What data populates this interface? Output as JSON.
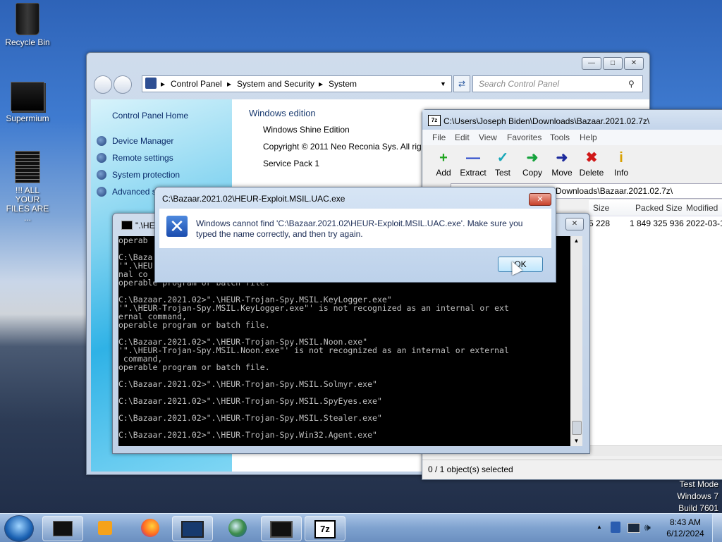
{
  "desktop": {
    "icons": [
      {
        "label": "Recycle Bin"
      },
      {
        "label": "Supermium"
      },
      {
        "label": "!!! ALL YOUR FILES ARE ..."
      }
    ],
    "watermark": [
      "Test Mode",
      "Windows 7",
      "Build 7601"
    ]
  },
  "control_panel": {
    "breadcrumb": [
      "Control Panel",
      "System and Security",
      "System"
    ],
    "search_placeholder": "Search Control Panel",
    "home_link": "Control Panel Home",
    "side_links": [
      "Device Manager",
      "Remote settings",
      "System protection",
      "Advanced s"
    ],
    "section_title": "Windows edition",
    "edition": "Windows Shine Edition",
    "copyright": "Copyright © 2011 Neo Reconia Sys.  All rig",
    "service_pack": "Service Pack 1"
  },
  "console": {
    "title": "\".\\HE",
    "lines": [
      "operab",
      "",
      "C:\\Baza",
      "'\".\\HEU",
      "nal co",
      "operable program or batch file.",
      "",
      "C:\\Bazaar.2021.02>\".\\HEUR-Trojan-Spy.MSIL.KeyLogger.exe\"",
      "'\".\\HEUR-Trojan-Spy.MSIL.KeyLogger.exe\"' is not recognized as an internal or ext",
      "ernal command,",
      "operable program or batch file.",
      "",
      "C:\\Bazaar.2021.02>\".\\HEUR-Trojan-Spy.MSIL.Noon.exe\"",
      "'\".\\HEUR-Trojan-Spy.MSIL.Noon.exe\"' is not recognized as an internal or external",
      " command,",
      "operable program or batch file.",
      "",
      "C:\\Bazaar.2021.02>\".\\HEUR-Trojan-Spy.MSIL.Solmyr.exe\"",
      "",
      "C:\\Bazaar.2021.02>\".\\HEUR-Trojan-Spy.MSIL.SpyEyes.exe\"",
      "",
      "C:\\Bazaar.2021.02>\".\\HEUR-Trojan-Spy.MSIL.Stealer.exe\"",
      "",
      "C:\\Bazaar.2021.02>\".\\HEUR-Trojan-Spy.Win32.Agent.exe\""
    ]
  },
  "sevenzip": {
    "title": "C:\\Users\\Joseph Biden\\Downloads\\Bazaar.2021.02.7z\\",
    "menu": [
      "File",
      "Edit",
      "View",
      "Favorites",
      "Tools",
      "Help"
    ],
    "toolbar": [
      {
        "label": "Add",
        "glyph": "+",
        "color": "#1fa51f"
      },
      {
        "label": "Extract",
        "glyph": "—",
        "color": "#2040c8"
      },
      {
        "label": "Test",
        "glyph": "✓",
        "color": "#18a7b8"
      },
      {
        "label": "Copy",
        "glyph": "➜",
        "color": "#16a23c"
      },
      {
        "label": "Move",
        "glyph": "➜",
        "color": "#1c2a9c"
      },
      {
        "label": "Delete",
        "glyph": "✖",
        "color": "#d01818"
      },
      {
        "label": "Info",
        "glyph": "i",
        "color": "#d8a000"
      }
    ],
    "path": "Downloads\\Bazaar.2021.02.7z\\",
    "columns": [
      "Size",
      "Packed Size",
      "Modified"
    ],
    "row": {
      "size": "5 228",
      "packed": "1 849 325 936",
      "modified": "2022-03-1"
    },
    "status": "0 / 1 object(s) selected"
  },
  "dialog": {
    "title": "C:\\Bazaar.2021.02\\HEUR-Exploit.MSIL.UAC.exe",
    "message": "Windows cannot find 'C:\\Bazaar.2021.02\\HEUR-Exploit.MSIL.UAC.exe'. Make sure you typed the name correctly, and then try again.",
    "ok_label": "OK"
  },
  "taskbar": {
    "time": "8:43 AM",
    "date": "6/12/2024",
    "tray_arrow": "▲"
  }
}
